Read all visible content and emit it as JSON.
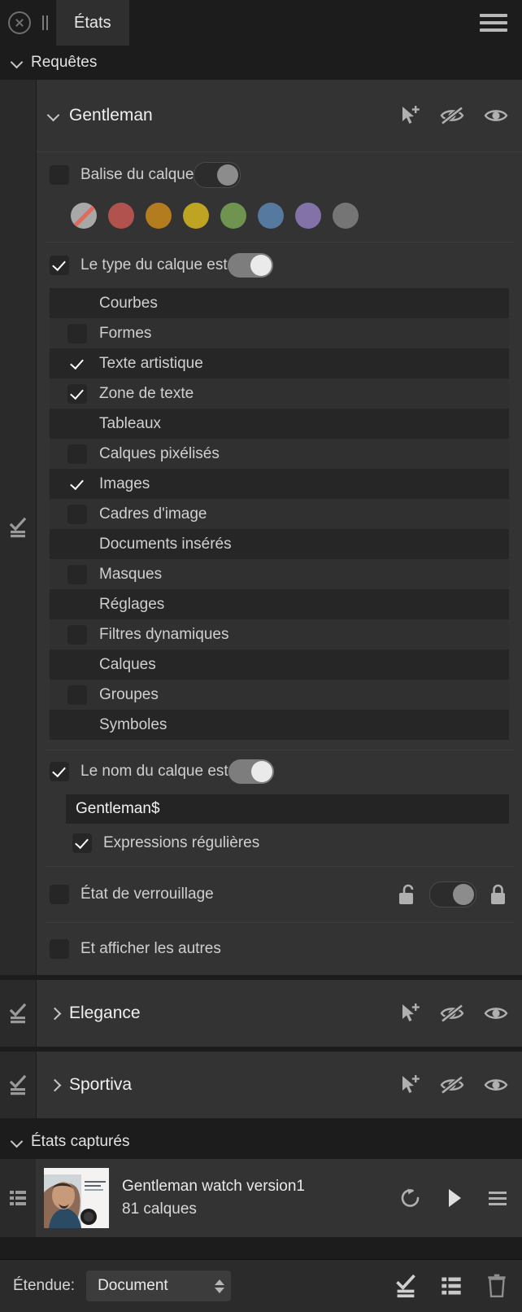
{
  "titlebar": {
    "close_icon": "close-circle-icon",
    "pause_icon": "pause-bars-icon",
    "tab_label": "États",
    "menu_icon": "hamburger-menu-icon"
  },
  "sections": {
    "queries": {
      "label": "Requêtes",
      "expanded": true
    },
    "captured": {
      "label": "États capturés",
      "expanded": true
    }
  },
  "query": {
    "name": "Gentleman",
    "expanded": true,
    "header_icons": [
      "cursor-add-icon",
      "eye-hidden-icon",
      "eye-visible-icon"
    ],
    "tag": {
      "label": "Balise du calque",
      "checked": false,
      "toggle_on": false,
      "swatches": [
        {
          "name": "none",
          "color": "#a8a8a8"
        },
        {
          "name": "red",
          "color": "#b2524e"
        },
        {
          "name": "orange",
          "color": "#b37c1e"
        },
        {
          "name": "yellow",
          "color": "#bfa322"
        },
        {
          "name": "green",
          "color": "#6f9450"
        },
        {
          "name": "blue",
          "color": "#55799f"
        },
        {
          "name": "purple",
          "color": "#8272a8"
        },
        {
          "name": "grey",
          "color": "#757575"
        }
      ]
    },
    "layer_type": {
      "label": "Le type du calque est",
      "checked": true,
      "toggle_on": true,
      "items": [
        {
          "label": "Courbes",
          "checked": false
        },
        {
          "label": "Formes",
          "checked": false
        },
        {
          "label": "Texte artistique",
          "checked": true
        },
        {
          "label": "Zone de texte",
          "checked": true
        },
        {
          "label": "Tableaux",
          "checked": false
        },
        {
          "label": "Calques pixélisés",
          "checked": false
        },
        {
          "label": "Images",
          "checked": true
        },
        {
          "label": "Cadres d'image",
          "checked": false
        },
        {
          "label": "Documents insérés",
          "checked": false
        },
        {
          "label": "Masques",
          "checked": false
        },
        {
          "label": "Réglages",
          "checked": false
        },
        {
          "label": "Filtres dynamiques",
          "checked": false
        },
        {
          "label": "Calques",
          "checked": false
        },
        {
          "label": "Groupes",
          "checked": false
        },
        {
          "label": "Symboles",
          "checked": false
        }
      ]
    },
    "layer_name": {
      "label": "Le nom du calque est",
      "checked": true,
      "toggle_on": true,
      "value": "Gentleman$",
      "regex": {
        "label": "Expressions régulières",
        "checked": true
      }
    },
    "lock_state": {
      "label": "État de verrouillage",
      "checked": false,
      "toggle_on": false,
      "unlock_icon": "unlock-icon",
      "lock_icon": "lock-icon"
    },
    "show_others": {
      "label": "Et afficher les autres",
      "checked": false
    }
  },
  "other_queries": [
    {
      "name": "Elegance",
      "expanded": false,
      "icons": [
        "cursor-add-icon",
        "eye-hidden-icon",
        "eye-visible-icon"
      ]
    },
    {
      "name": "Sportiva",
      "expanded": false,
      "icons": [
        "cursor-add-icon",
        "eye-hidden-icon",
        "eye-visible-icon"
      ]
    }
  ],
  "captured_states": [
    {
      "title": "Gentleman watch version1",
      "subtitle": "81 calques",
      "icons": [
        "restore-icon",
        "play-icon",
        "menu-icon"
      ]
    }
  ],
  "footer": {
    "scope_label": "Étendue:",
    "scope_value": "Document",
    "icons": [
      "apply-check-icon",
      "list-icon",
      "trash-icon"
    ]
  },
  "colors": {
    "panel_bg": "#1c1c1c",
    "card_bg": "#333333",
    "list_bg": "#262626",
    "list_alt_bg": "#303030",
    "gutter_bg": "#2a2a2a",
    "footer_bg": "#2b2b2b",
    "text": "#d4d4d4",
    "text_bright": "#f0f0f0"
  }
}
